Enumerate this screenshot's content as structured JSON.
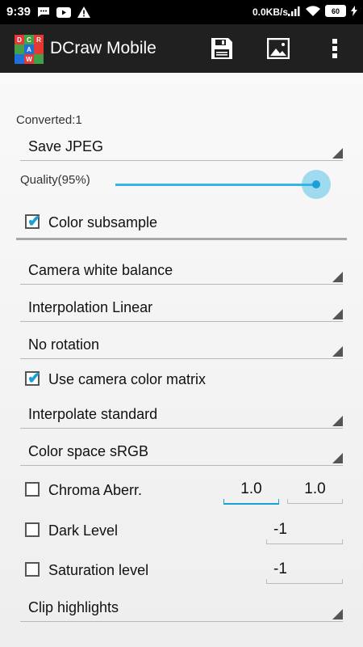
{
  "status_bar": {
    "time": "9:39",
    "network_speed": "0.0KB/s",
    "battery": "60"
  },
  "app_bar": {
    "logo_letters": [
      "D",
      "C",
      "R",
      "",
      "A",
      "",
      "",
      "W",
      ""
    ],
    "title": "DCraw Mobile",
    "actions": [
      "save-icon",
      "image-icon",
      "overflow-menu-icon"
    ]
  },
  "main": {
    "converted_label": "Converted:1",
    "save_format": "Save JPEG",
    "quality_label": "Quality(95%)",
    "quality_value": 95,
    "color_subsample": {
      "label": "Color subsample",
      "checked": true
    },
    "white_balance": "Camera white balance",
    "interpolation": "Interpolation Linear",
    "rotation": "No rotation",
    "camera_color_matrix": {
      "label": "Use camera color matrix",
      "checked": true
    },
    "interpolate_mode": "Interpolate standard",
    "color_space": "Color space sRGB",
    "chroma_aberr": {
      "label": "Chroma Aberr.",
      "checked": false,
      "value1": "1.0",
      "value2": "1.0"
    },
    "dark_level": {
      "label": "Dark Level",
      "checked": false,
      "value": "-1"
    },
    "saturation_level": {
      "label": "Saturation level",
      "checked": false,
      "value": "-1"
    },
    "clip_highlights": "Clip highlights"
  },
  "colors": {
    "accent": "#33b5e5",
    "appbar": "#202020",
    "logo_red": "#e53935",
    "logo_green": "#43a047",
    "logo_blue": "#1e6fd9"
  }
}
